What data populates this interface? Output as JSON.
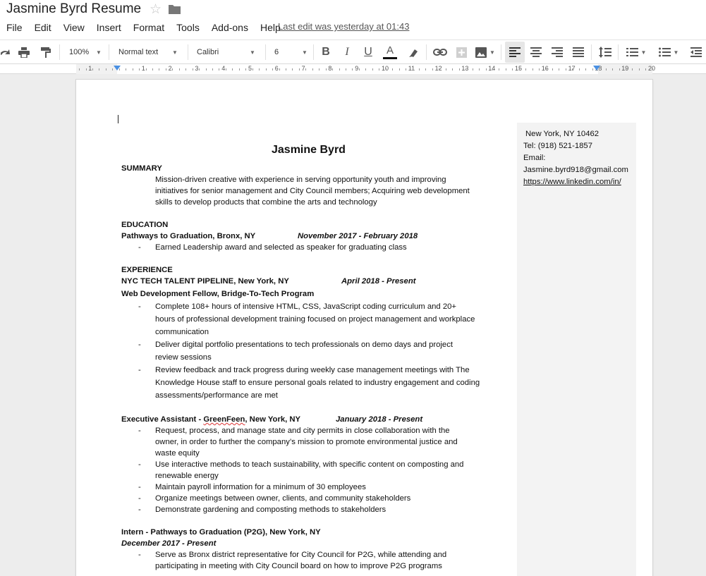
{
  "doc": {
    "title": "Jasmine Byrd Resume",
    "last_edit": "Last edit was yesterday at 01:43"
  },
  "menu": [
    "File",
    "Edit",
    "View",
    "Insert",
    "Format",
    "Tools",
    "Add-ons",
    "Help"
  ],
  "toolbar": {
    "zoom": "100%",
    "style": "Normal text",
    "font": "Calibri",
    "size": "6"
  },
  "ruler": {
    "numbers": [
      "1",
      "1",
      "2",
      "3",
      "4",
      "5",
      "6",
      "7",
      "8",
      "9",
      "10",
      "11",
      "12",
      "13",
      "14",
      "15",
      "16",
      "17",
      "18",
      "19",
      "20"
    ]
  },
  "resume": {
    "name": "Jasmine Byrd",
    "contact": {
      "city": "New York, NY 10462",
      "tel": "Tel: (918) 521-1857",
      "email_label": "Email:",
      "email": "Jasmine.byrd918@gmail.com",
      "linkedin": "https://www.linkedin.com/in/"
    },
    "summary": {
      "heading": "SUMMARY",
      "lines": [
        "Mission-driven creative with experience in serving opportunity youth and improving",
        "initiatives for senior management and City Council members; Acquiring web development",
        "skills to develop products that combine the arts and technology"
      ]
    },
    "education": {
      "heading": "EDUCATION",
      "org": "Pathways to Graduation, Bronx, NY",
      "dates": "November 2017 - February  2018",
      "bullet": "Earned Leadership award and selected as speaker for graduating class"
    },
    "experience": {
      "heading": "EXPERIENCE",
      "job1": {
        "org": "NYC TECH TALENT PIPELINE, New York, NY",
        "dates": "April 2018 - Present",
        "role": "Web Development Fellow, Bridge-To-Tech Program",
        "bullets": [
          [
            "Complete 108+ hours of intensive HTML, CSS, JavaScript coding        curriculum and 20+",
            "hours of professional development training focused on project management and workplace",
            "communication"
          ],
          [
            "Deliver digital portfolio presentations to tech professionals on     demo days and project",
            "review sessions"
          ],
          [
            "Review feedback and track progress during weekly case management meetings with The",
            "Knowledge House staff to ensure personal goals related to industry engagement and coding",
            "assessments/performance are met"
          ]
        ]
      },
      "job2": {
        "title_prefix": "Executive Assistant - ",
        "title_company": "GreenFeen",
        "title_suffix": ", New York, NY",
        "dates": "January 2018 - Present",
        "bullets": [
          [
            "Request, process, and manage state and city permits in close collaboration with the",
            "owner, in order to further the company’s mission to promote environmental justice and",
            "waste equity"
          ],
          [
            "Use interactive methods to teach sustainability, with specific content on composting and",
            "renewable energy"
          ],
          [
            "Maintain payroll information for a minimum of 30 employees"
          ],
          [
            "Organize meetings between owner, clients, and community stakeholders"
          ],
          [
            "Demonstrate gardening and composting methods to stakeholders"
          ]
        ]
      },
      "job3": {
        "title": "Intern - Pathways to Graduation (P2G), New York, NY",
        "dates": "December 2017 - Present",
        "bullets": [
          [
            "Serve as Bronx district representative for City Council for P2G, while attending and",
            "participating  in meeting with City Council board on how to improve P2G programs"
          ]
        ]
      }
    },
    "bullet_char": "-"
  }
}
